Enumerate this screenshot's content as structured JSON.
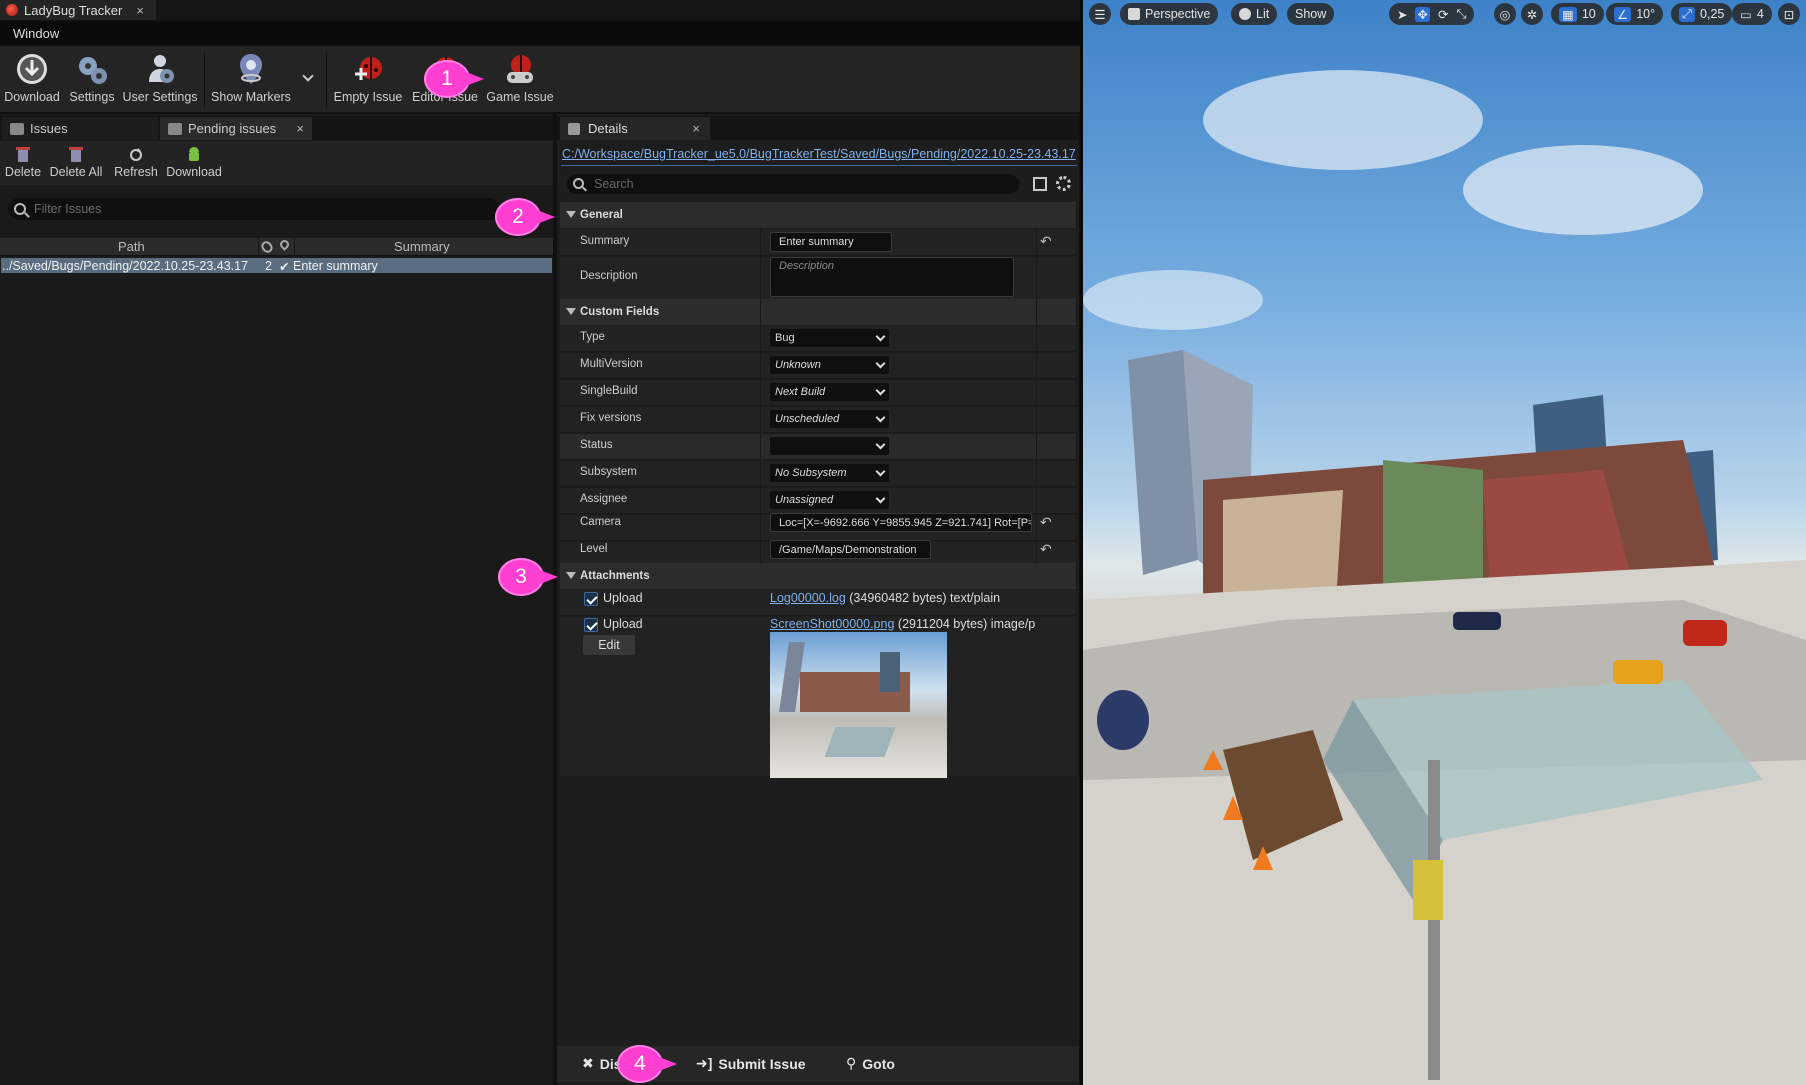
{
  "window": {
    "tab_title": "LadyBug Tracker",
    "close_glyph": "×",
    "menu": [
      "Window"
    ]
  },
  "toolbar": {
    "buttons": [
      {
        "label": "Download",
        "icon": "download-icon"
      },
      {
        "label": "Settings",
        "icon": "gears-icon"
      },
      {
        "label": "User Settings",
        "icon": "user-gear-icon"
      },
      {
        "label": "Show Markers",
        "icon": "marker-eye-icon"
      },
      {
        "label": "Empty Issue",
        "icon": "ladybug-add-icon"
      },
      {
        "label": "Editor Issue",
        "icon": "ladybug-editor-icon"
      },
      {
        "label": "Game Issue",
        "icon": "ladybug-gamepad-icon"
      }
    ]
  },
  "issues_panel": {
    "tabs": [
      {
        "label": "Issues"
      },
      {
        "label": "Pending issues",
        "close": "×"
      }
    ],
    "toolbar": [
      {
        "label": "Delete",
        "icon": "delete-icon"
      },
      {
        "label": "Delete All",
        "icon": "delete-all-icon"
      },
      {
        "label": "Refresh",
        "icon": "refresh-icon"
      },
      {
        "label": "Download",
        "icon": "android-icon"
      }
    ],
    "filter_placeholder": "Filter Issues",
    "columns": [
      "Path",
      "Summary"
    ],
    "rows": [
      {
        "path": "../Saved/Bugs/Pending/2022.10.25-23.43.17",
        "attachments": "2",
        "check": "✔",
        "summary": "Enter summary"
      }
    ]
  },
  "details": {
    "tab": "Details",
    "tab_close": "×",
    "path": "C:/Workspace/BugTracker_ue5.0/BugTrackerTest/Saved/Bugs/Pending/2022.10.25-23.43.17",
    "search_placeholder": "Search",
    "sections": {
      "general": {
        "title": "General",
        "summary_label": "Summary",
        "summary_value": "Enter summary",
        "description_label": "Description",
        "description_placeholder": "Description"
      },
      "custom": {
        "title": "Custom Fields",
        "fields": [
          {
            "label": "Type",
            "value": "Bug"
          },
          {
            "label": "MultiVersion",
            "value": "Unknown"
          },
          {
            "label": "SingleBuild",
            "value": "Next Build"
          },
          {
            "label": "Fix versions",
            "value": "Unscheduled"
          },
          {
            "label": "Status",
            "value": ""
          },
          {
            "label": "Subsystem",
            "value": "No Subsystem"
          },
          {
            "label": "Assignee",
            "value": "Unassigned"
          }
        ],
        "camera_label": "Camera",
        "camera_value": "Loc=[X=-9692.666 Y=9855.945 Z=921.741] Rot=[P=",
        "level_label": "Level",
        "level_value": "/Game/Maps/Demonstration"
      },
      "attachments": {
        "title": "Attachments",
        "items": [
          {
            "upload_label": "Upload",
            "file": "Log00000.log",
            "info": "(34960482 bytes) text/plain"
          },
          {
            "upload_label": "Upload",
            "file": "ScreenShot00000.png",
            "info": "(2911204 bytes) image/p"
          }
        ],
        "edit_label": "Edit"
      }
    },
    "footer": {
      "discard": "Dis",
      "submit": "Submit Issue",
      "goto": "Goto"
    }
  },
  "callouts": [
    "1",
    "2",
    "3",
    "4"
  ],
  "viewport": {
    "menu_icon": "hamburger-icon",
    "perspective": "Perspective",
    "lit": "Lit",
    "show": "Show",
    "grid_snap": "10",
    "angle_snap": "10°",
    "scale_snap": "0,25",
    "camera_speed": "4"
  }
}
